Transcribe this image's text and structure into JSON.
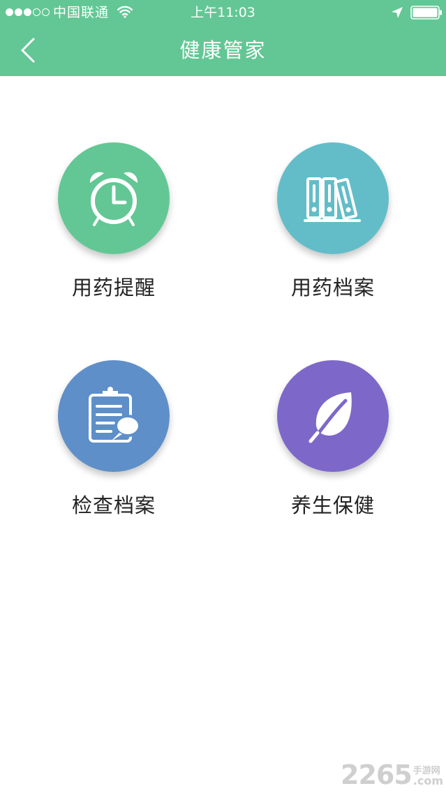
{
  "status_bar": {
    "carrier": "中国联通",
    "time": "上午11:03",
    "signal_bars_filled": 3,
    "signal_bars_total": 5
  },
  "nav": {
    "title": "健康管家"
  },
  "colors": {
    "header": "#62c794",
    "medication_reminder": "#62c794",
    "medication_records": "#63bdc8",
    "checkup_records": "#5e8fc8",
    "health_care": "#7d68c9"
  },
  "features": [
    {
      "label": "用药提醒",
      "icon": "alarm-clock-icon"
    },
    {
      "label": "用药档案",
      "icon": "binders-icon"
    },
    {
      "label": "检查档案",
      "icon": "clipboard-chat-icon"
    },
    {
      "label": "养生保健",
      "icon": "leaf-icon"
    }
  ],
  "watermark": {
    "number": "2265",
    "site": "手游网",
    "domain": ".com"
  }
}
